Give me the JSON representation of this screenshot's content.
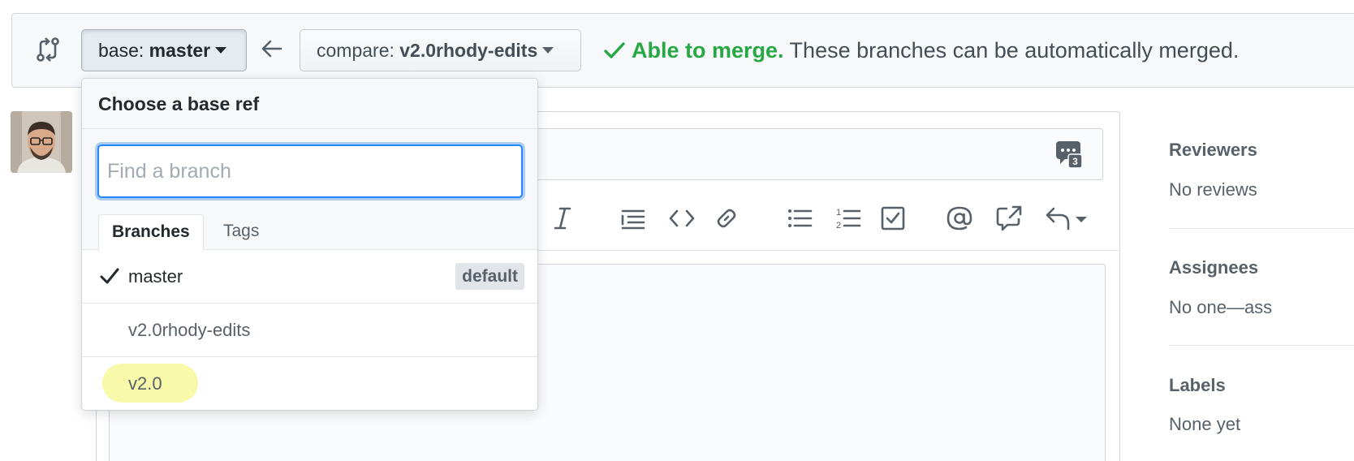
{
  "range_bar": {
    "base_prefix": "base: ",
    "base_branch": "master",
    "compare_prefix": "compare: ",
    "compare_branch": "v2.0rhody-edits",
    "merge_status_strong": "Able to merge.",
    "merge_status_detail": " These branches can be automatically merged."
  },
  "dropdown": {
    "title": "Choose a base ref",
    "filter_placeholder": "Find a branch",
    "tabs": [
      {
        "label": "Branches",
        "active": true
      },
      {
        "label": "Tags",
        "active": false
      }
    ],
    "items": [
      {
        "label": "master",
        "selected": true,
        "badge": "default"
      },
      {
        "label": "v2.0rhody-edits",
        "selected": false
      },
      {
        "label": "v2.0",
        "selected": false
      }
    ]
  },
  "sidebar": {
    "reviewers_heading": "Reviewers",
    "reviewers_value": "No reviews",
    "assignees_heading": "Assignees",
    "assignees_value": "No one—ass",
    "labels_heading": "Labels",
    "labels_value": "None yet"
  },
  "saved_replies_count": "3",
  "colors": {
    "success": "#28a745",
    "focus": "#2188ff",
    "highlight": "#f4f464"
  },
  "icons": {
    "compare": "git-compare-icon",
    "arrow": "arrow-left-icon",
    "check": "check-icon",
    "saved_replies": "saved-replies-icon"
  }
}
